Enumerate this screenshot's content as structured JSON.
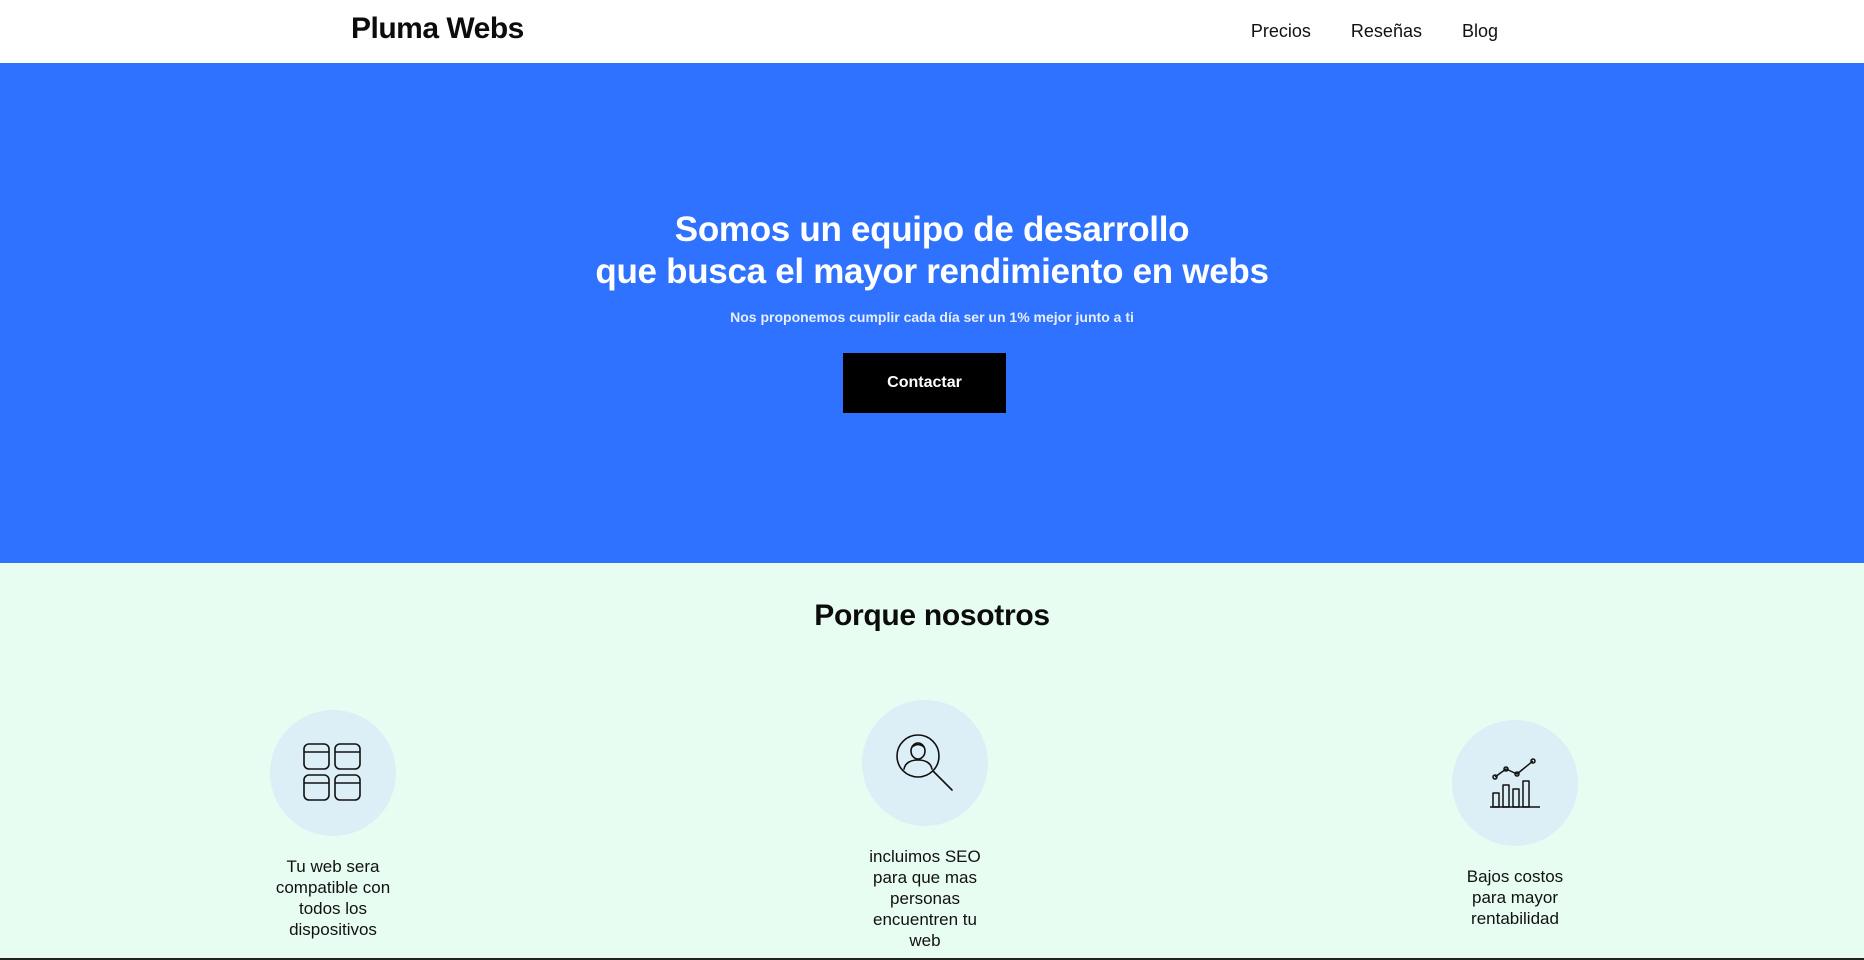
{
  "header": {
    "logo": "Pluma Webs",
    "nav": [
      "Precios",
      "Reseñas",
      "Blog"
    ]
  },
  "hero": {
    "title_line1": "Somos un equipo de desarrollo",
    "title_line2": "que busca el mayor rendimiento en webs",
    "subtitle": "Nos proponemos cumplir cada día ser un 1% mejor junto a ti",
    "button": "Contactar",
    "background": "#2f72ff"
  },
  "features": {
    "title": "Porque nosotros",
    "background": "#e8fdf2",
    "items": [
      {
        "icon": "grid-layout-icon",
        "text": "Tu web sera compatible con todos los dispositivos"
      },
      {
        "icon": "search-person-icon",
        "text": "incluimos SEO para que mas personas encuentren tu web"
      },
      {
        "icon": "growth-chart-icon",
        "text": "Bajos costos para mayor rentabilidad"
      }
    ]
  }
}
